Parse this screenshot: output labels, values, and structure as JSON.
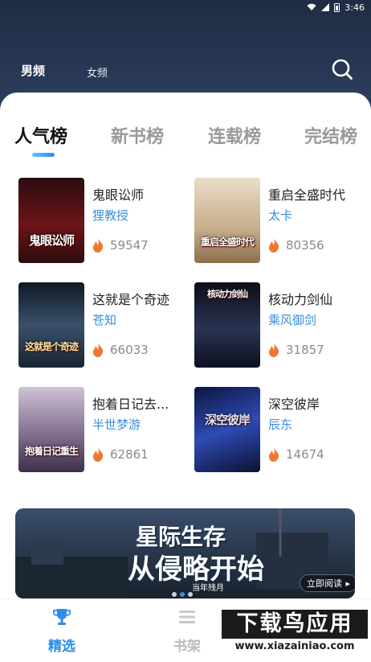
{
  "status_bar": {
    "time": "3:46"
  },
  "header": {
    "categories": [
      {
        "label": "男频",
        "active": true
      },
      {
        "label": "女频",
        "active": false
      }
    ],
    "search_icon": "search-icon"
  },
  "rank_tabs": [
    {
      "label": "人气榜",
      "active": true
    },
    {
      "label": "新书榜",
      "active": false
    },
    {
      "label": "连载榜",
      "active": false
    },
    {
      "label": "完结榜",
      "active": false
    }
  ],
  "books": [
    {
      "title": "鬼眼讼师",
      "author": "狸教授",
      "heat": "59547",
      "cover_text": "鬼眼讼师",
      "cover_color": "#5a0f12"
    },
    {
      "title": "重启全盛时代",
      "author": "太卡",
      "heat": "80356",
      "cover_text": "重启全盛时代",
      "cover_color": "#c9b59a"
    },
    {
      "title": "这就是个奇迹",
      "author": "苍知",
      "heat": "66033",
      "cover_text": "这就是个奇迹",
      "cover_color": "#2b3a4e"
    },
    {
      "title": "核动力剑仙",
      "author": "乘风御剑",
      "heat": "31857",
      "cover_text": "核动力剑仙",
      "cover_color": "#1d2233"
    },
    {
      "title": "抱着日记去...",
      "author": "半世梦游",
      "heat": "62861",
      "cover_text": "抱着日记重生",
      "cover_color": "#7b6a86"
    },
    {
      "title": "深空彼岸",
      "author": "辰东",
      "heat": "14674",
      "cover_text": "深空彼岸",
      "cover_color": "#1a2e73"
    }
  ],
  "banner": {
    "line1": "星际生存",
    "line2": "从侵略开始",
    "sub": "当年残月",
    "button": "立即阅读"
  },
  "bottom_nav": [
    {
      "label": "精选",
      "active": true
    },
    {
      "label": "书架",
      "active": false
    }
  ],
  "watermark": {
    "big": "下载鸟应用",
    "url": "www.xiazainiao.com"
  },
  "colors": {
    "accent": "#2f8ce8",
    "author_link": "#3a8ee0",
    "fire": "#f2762d"
  }
}
